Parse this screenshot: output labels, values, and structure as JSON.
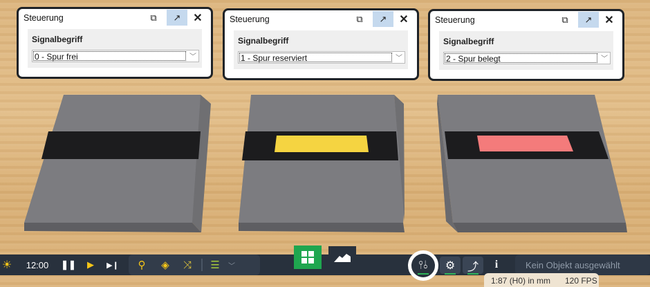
{
  "panels": [
    {
      "title": "Steuerung",
      "label": "Signalbegriff",
      "value": "0 - Spur frei"
    },
    {
      "title": "Steuerung",
      "label": "Signalbegriff",
      "value": "1 - Spur reserviert"
    },
    {
      "title": "Steuerung",
      "label": "Signalbegriff",
      "value": "2 - Spur belegt"
    }
  ],
  "signal_colors": [
    "#1e1e1e",
    "#f5d441",
    "#f47b7b"
  ],
  "toolbar": {
    "time": "12:00",
    "selection": "Kein Objekt ausgewählt"
  },
  "status": {
    "scale": "1:87 (H0) in mm",
    "fps": "120 FPS"
  }
}
